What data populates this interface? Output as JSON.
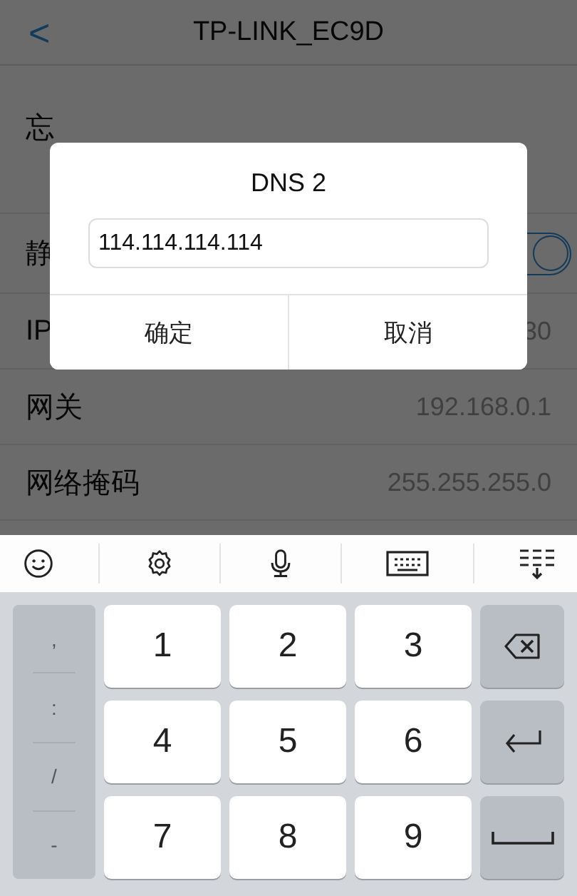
{
  "header": {
    "back": "<",
    "title": "TP-LINK_EC9D"
  },
  "rows": [
    {
      "kind": "action",
      "label": "忘"
    },
    {
      "kind": "toggle",
      "label": "静",
      "on": true
    },
    {
      "kind": "value",
      "label": "IP",
      "value": "30"
    },
    {
      "kind": "value",
      "label": "网关",
      "value": "192.168.0.1"
    },
    {
      "kind": "value",
      "label": "网络掩码",
      "value": "255.255.255.0"
    }
  ],
  "dialog": {
    "title": "DNS 2",
    "value": "114.114.114.114",
    "buttons": [
      "确定",
      "取消"
    ]
  },
  "keyboard": {
    "symbols": [
      ",",
      ":",
      "/",
      "-"
    ],
    "digits": [
      [
        "1",
        "2",
        "3"
      ],
      [
        "4",
        "5",
        "6"
      ],
      [
        "7",
        "8",
        "9"
      ]
    ]
  }
}
